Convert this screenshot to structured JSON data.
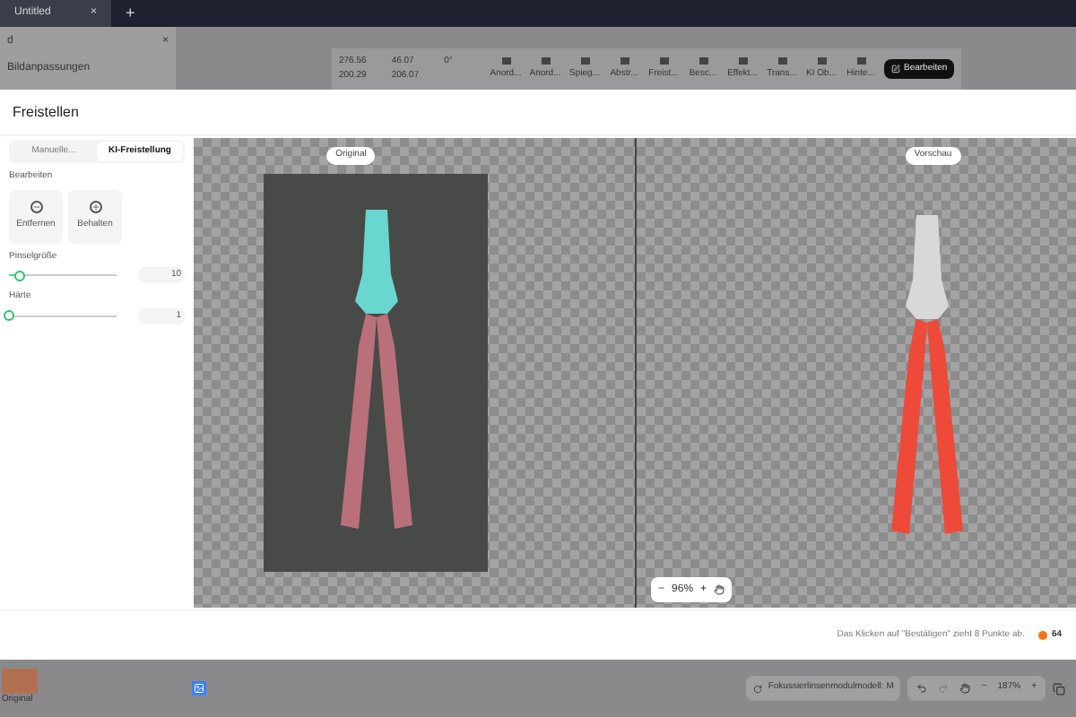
{
  "app_tab": {
    "title": "Untitled",
    "close": "×",
    "add": "+"
  },
  "sidebar": {
    "title": "d",
    "close": "×",
    "item": "Bildanpassungen"
  },
  "toolbar": {
    "fields": [
      "276.56",
      "46.07",
      "0°",
      "200.29",
      "206.07"
    ],
    "tools": [
      "Anord...",
      "Anord...",
      "Spieg...",
      "Abstr...",
      "Freist...",
      "Besc...",
      "Effekt...",
      "Trans...",
      "KI Ob...",
      "Hinte..."
    ],
    "edit_button": "Bearbeiten"
  },
  "dialog": {
    "title": "Freistellen",
    "tabs": [
      {
        "label": "Manuelle...",
        "selected": false
      },
      {
        "label": "KI-Freistellung",
        "selected": true
      }
    ],
    "section": "Bearbeiten",
    "actions": [
      {
        "kind": "minus",
        "label": "Entfernen"
      },
      {
        "kind": "plus",
        "label": "Behalten"
      }
    ],
    "sliders": [
      {
        "label": "Pinselgröße",
        "level": 0.1,
        "value": "10"
      },
      {
        "label": "Härte",
        "level": 0,
        "value": "1"
      }
    ],
    "original_label": "Original",
    "preview_label": "Vorschau",
    "zoom": {
      "minus": "−",
      "value": "96%",
      "plus": "+"
    },
    "footer_note": "Das Klicken auf \"Bestätigen\" zieht 8 Punkte ab.",
    "points": "64"
  },
  "bottom_bar": {
    "thumb_label": "Original",
    "model": "Fokussierlinsenmodulmodell: M",
    "zoom": "187%",
    "minus": "−",
    "plus": "+"
  }
}
